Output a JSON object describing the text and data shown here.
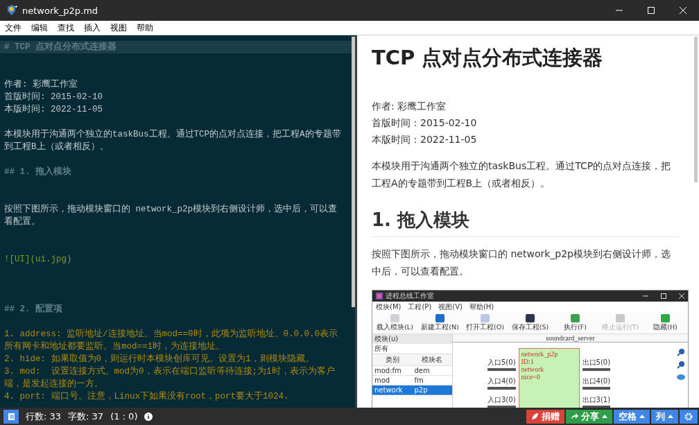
{
  "window": {
    "title": "network_p2p.md"
  },
  "menu": [
    "文件",
    "编辑",
    "查找",
    "插入",
    "视图",
    "帮助"
  ],
  "editor": {
    "lines": [
      {
        "kind": "heading",
        "text": "# TCP 点对点分布式连接器",
        "current": true
      },
      {
        "kind": "text",
        "text": "作者: 彩鹰工作室",
        "current": false
      },
      {
        "kind": "text",
        "text": "首版时间: 2015-02-10",
        "current": false
      },
      {
        "kind": "text",
        "text": "本版时间: 2022-11-05",
        "current": false
      },
      {
        "kind": "text",
        "text": "本模块用于沟通两个独立的taskBus工程。通过TCP的点对点连接，把工程A的专题带到工程B上（或者相反）。",
        "current": false
      },
      {
        "kind": "heading",
        "text": "## 1. 拖入模块",
        "current": false
      },
      {
        "kind": "text",
        "text": "按照下图所示，拖动模块窗口的 network_p2p模块到右侧设计师，选中后，可以查看配置。",
        "current": false
      },
      {
        "kind": "image",
        "text": "![UI](ui.jpg)",
        "current": false
      },
      {
        "kind": "heading",
        "text": "## 2. 配置项",
        "current": false
      },
      {
        "kind": "list",
        "text": "1. address: 监听地址/连接地址。当mod==0时，此项为监听地址。0.0.0.0表示所有网卡和地址都要监听。当mod==1时，为连接地址。",
        "current": false
      },
      {
        "kind": "list",
        "text": "2. hide: 如果取值为0，则运行时本模块创库可见。设置为1，则模块隐藏。",
        "current": false
      },
      {
        "kind": "list",
        "text": "3. mod:  设置连接方式。mod为0，表示在端口监听等待连接;为1时，表示为客户端，是发起连接的一方。",
        "current": false
      },
      {
        "kind": "list",
        "text": "4. port: 端口号。注意，Linux下如果没有root，port要大于1024.",
        "current": false
      }
    ]
  },
  "preview": {
    "blocks": [
      {
        "kind": "h1",
        "text": "TCP 点对点分布式连接器"
      },
      {
        "kind": "meta",
        "text": "作者: 彩鹰工作室"
      },
      {
        "kind": "meta",
        "text": "首版时间：2015-02-10"
      },
      {
        "kind": "meta",
        "text": "本版时间：2022-11-05"
      },
      {
        "kind": "para",
        "text": "本模块用于沟通两个独立的taskBus工程。通过TCP的点对点连接，把工程A的专题带到工程B上（或者相反）。"
      },
      {
        "kind": "h2",
        "text": "1. 拖入模块"
      },
      {
        "kind": "para",
        "text": "按照下图所示，拖动模块窗口的 network_p2p模块到右侧设计师，选中后，可以查看配置。"
      }
    ],
    "ui_screenshot": {
      "title": "进程总线工作室",
      "menu": [
        "模块(M)",
        "工程(P)",
        "视图(V)",
        "帮助(H)"
      ],
      "toolbar": [
        {
          "label": "载入模块(L)",
          "disabled": false
        },
        {
          "label": "新建工程(N)",
          "disabled": false
        },
        {
          "label": "打开工程(O)",
          "disabled": false
        },
        {
          "label": "保存工程(S)",
          "disabled": false
        },
        {
          "label": "执行(F)",
          "disabled": false
        },
        {
          "label": "终止运行(T)",
          "disabled": true
        },
        {
          "label": "隐藏(H)",
          "disabled": false
        }
      ],
      "panel_title": "模块(u)",
      "filter": "所有",
      "columns": [
        "类别",
        "模块名"
      ],
      "rows": [
        {
          "cells": [
            "mod:fm",
            "dem"
          ],
          "selected": false
        },
        {
          "cells": [
            "mod",
            "fm"
          ],
          "selected": false
        },
        {
          "cells": [
            "network",
            "p2p"
          ],
          "selected": true
        }
      ],
      "tab": "soundcard_server",
      "node": {
        "lines": [
          "network_p2p",
          "ID:1",
          "network",
          "nice=0"
        ],
        "inputs": [
          "入口5(0)",
          "入口4(0)",
          "入口3(0)"
        ],
        "outputs": [
          "出口5(0)",
          "出口4(0)",
          "出口3(1)"
        ]
      }
    }
  },
  "status_bar": {
    "lines": "行数: 33",
    "chars": "字数: 37",
    "position": "(1 : 0)",
    "buttons": [
      {
        "kind": "donate",
        "label": "捐赠",
        "color": "#d9443a"
      },
      {
        "kind": "share",
        "label": "分享",
        "color": "#2e9e4a"
      },
      {
        "kind": "menu",
        "label": "空格",
        "color": "#3f86e6"
      },
      {
        "kind": "menu",
        "label": "列",
        "color": "#3f86e6"
      },
      {
        "kind": "settings",
        "color": "#3f86e6"
      }
    ]
  }
}
